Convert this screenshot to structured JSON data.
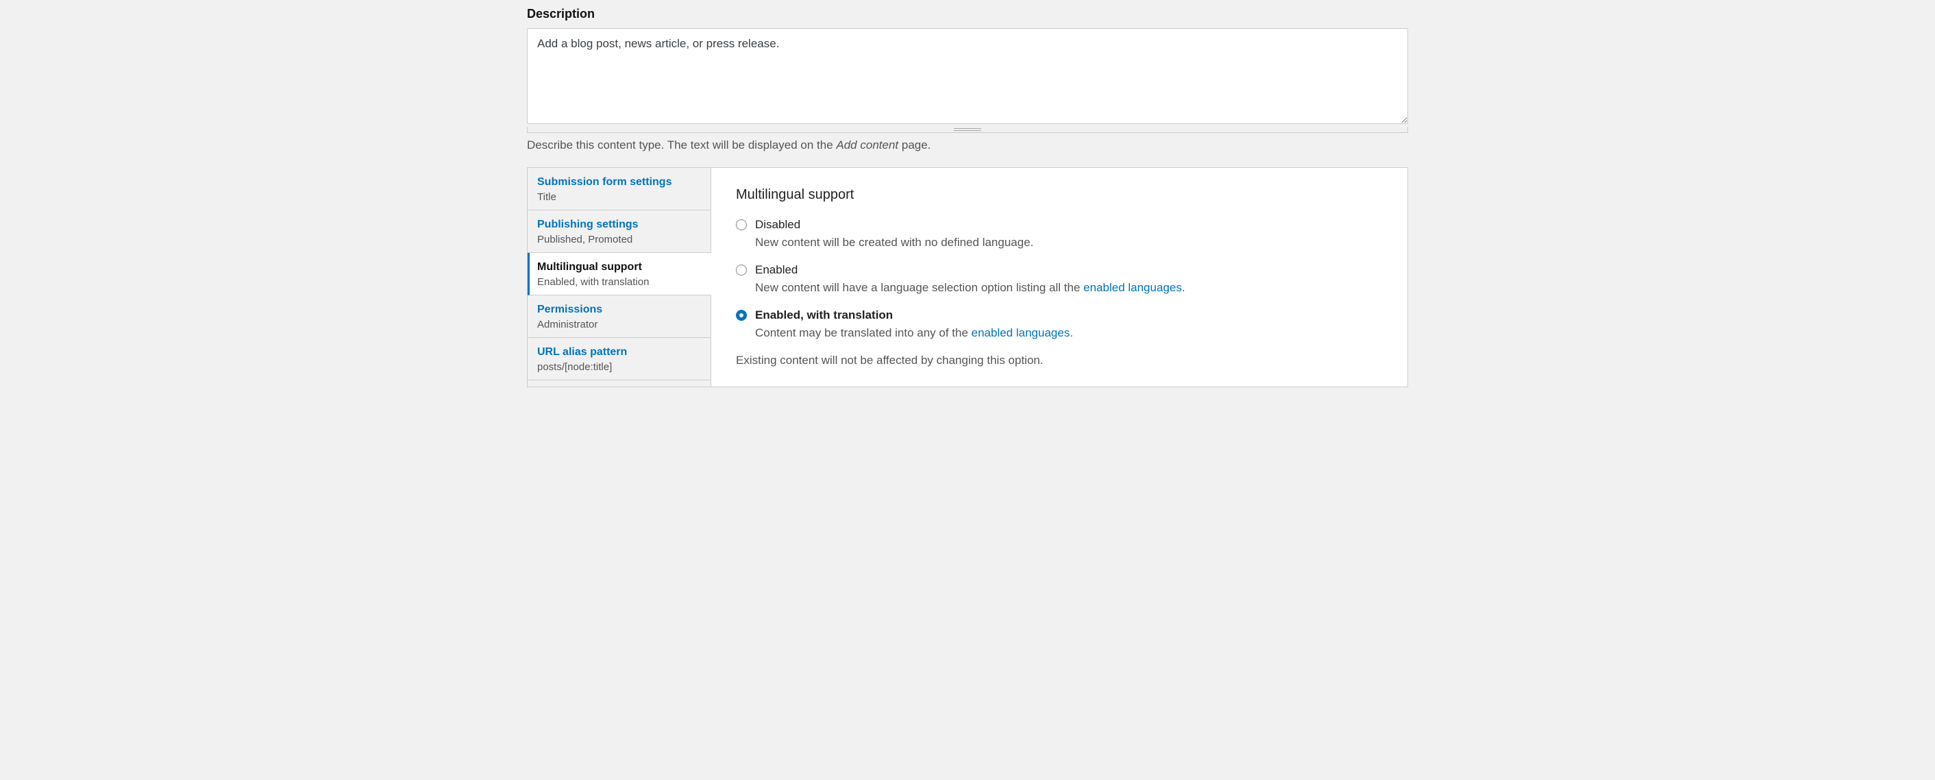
{
  "description": {
    "label": "Description",
    "value": "Add a blog post, news article, or press release.",
    "help_prefix": "Describe this content type. The text will be displayed on the ",
    "help_em": "Add content",
    "help_suffix": " page."
  },
  "tabs": [
    {
      "title": "Submission form settings",
      "summary": "Title"
    },
    {
      "title": "Publishing settings",
      "summary": "Published, Promoted"
    },
    {
      "title": "Multilingual support",
      "summary": "Enabled, with translation"
    },
    {
      "title": "Permissions",
      "summary": "Administrator"
    },
    {
      "title": "URL alias pattern",
      "summary": "posts/[node:title]"
    }
  ],
  "active_tab_index": 2,
  "pane": {
    "heading": "Multilingual support",
    "options": [
      {
        "label": "Disabled",
        "desc_full": "New content will be created with no defined language.",
        "checked": false
      },
      {
        "label": "Enabled",
        "desc_prefix": "New content will have a language selection option listing all the ",
        "desc_link": "enabled languages",
        "desc_suffix": ".",
        "checked": false
      },
      {
        "label": "Enabled, with translation",
        "desc_prefix": "Content may be translated into any of the ",
        "desc_link": "enabled languages",
        "desc_suffix": ".",
        "checked": true
      }
    ],
    "note": "Existing content will not be affected by changing this option."
  }
}
